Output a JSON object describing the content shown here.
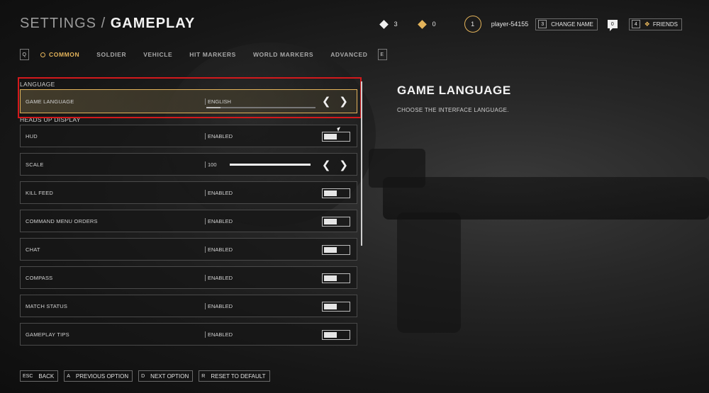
{
  "header": {
    "breadcrumb": "SETTINGS",
    "separator": "/",
    "page": "GAMEPLAY"
  },
  "topbar": {
    "currency_white": "3",
    "currency_gold": "0",
    "level": "1",
    "player_name": "player-54155",
    "change_name_key": "3",
    "change_name_label": "CHANGE NAME",
    "messages_count": "0",
    "friends_key": "4",
    "friends_label": "FRIENDS",
    "colors": {
      "accent": "#e3b35a"
    }
  },
  "tabs": {
    "left_key": "Q",
    "right_key": "E",
    "items": [
      {
        "label": "COMMON",
        "active": true
      },
      {
        "label": "SOLDIER"
      },
      {
        "label": "VEHICLE"
      },
      {
        "label": "HIT MARKERS"
      },
      {
        "label": "WORLD MARKERS"
      },
      {
        "label": "ADVANCED"
      }
    ]
  },
  "sections": {
    "language": "LANGUAGE",
    "hud": "HEADS UP DISPLAY"
  },
  "settings": {
    "game_language": {
      "name": "GAME LANGUAGE",
      "value": "ENGLISH"
    },
    "hud": {
      "name": "HUD",
      "value": "ENABLED"
    },
    "scale": {
      "name": "SCALE",
      "value": "100",
      "level": 1.0
    },
    "kill_feed": {
      "name": "KILL FEED",
      "value": "ENABLED"
    },
    "command_menu_orders": {
      "name": "COMMAND MENU ORDERS",
      "value": "ENABLED"
    },
    "chat": {
      "name": "CHAT",
      "value": "ENABLED"
    },
    "compass": {
      "name": "COMPASS",
      "value": "ENABLED"
    },
    "match_status": {
      "name": "MATCH STATUS",
      "value": "ENABLED"
    },
    "gameplay_tips": {
      "name": "GAMEPLAY TIPS",
      "value": "ENABLED"
    }
  },
  "description": {
    "title": "GAME LANGUAGE",
    "text": "CHOOSE THE INTERFACE LANGUAGE."
  },
  "bottom": {
    "back_key": "ESC",
    "back_label": "BACK",
    "prev_key": "A",
    "prev_label": "PREVIOUS OPTION",
    "next_key": "D",
    "next_label": "NEXT OPTION",
    "reset_key": "R",
    "reset_label": "RESET TO DEFAULT"
  }
}
